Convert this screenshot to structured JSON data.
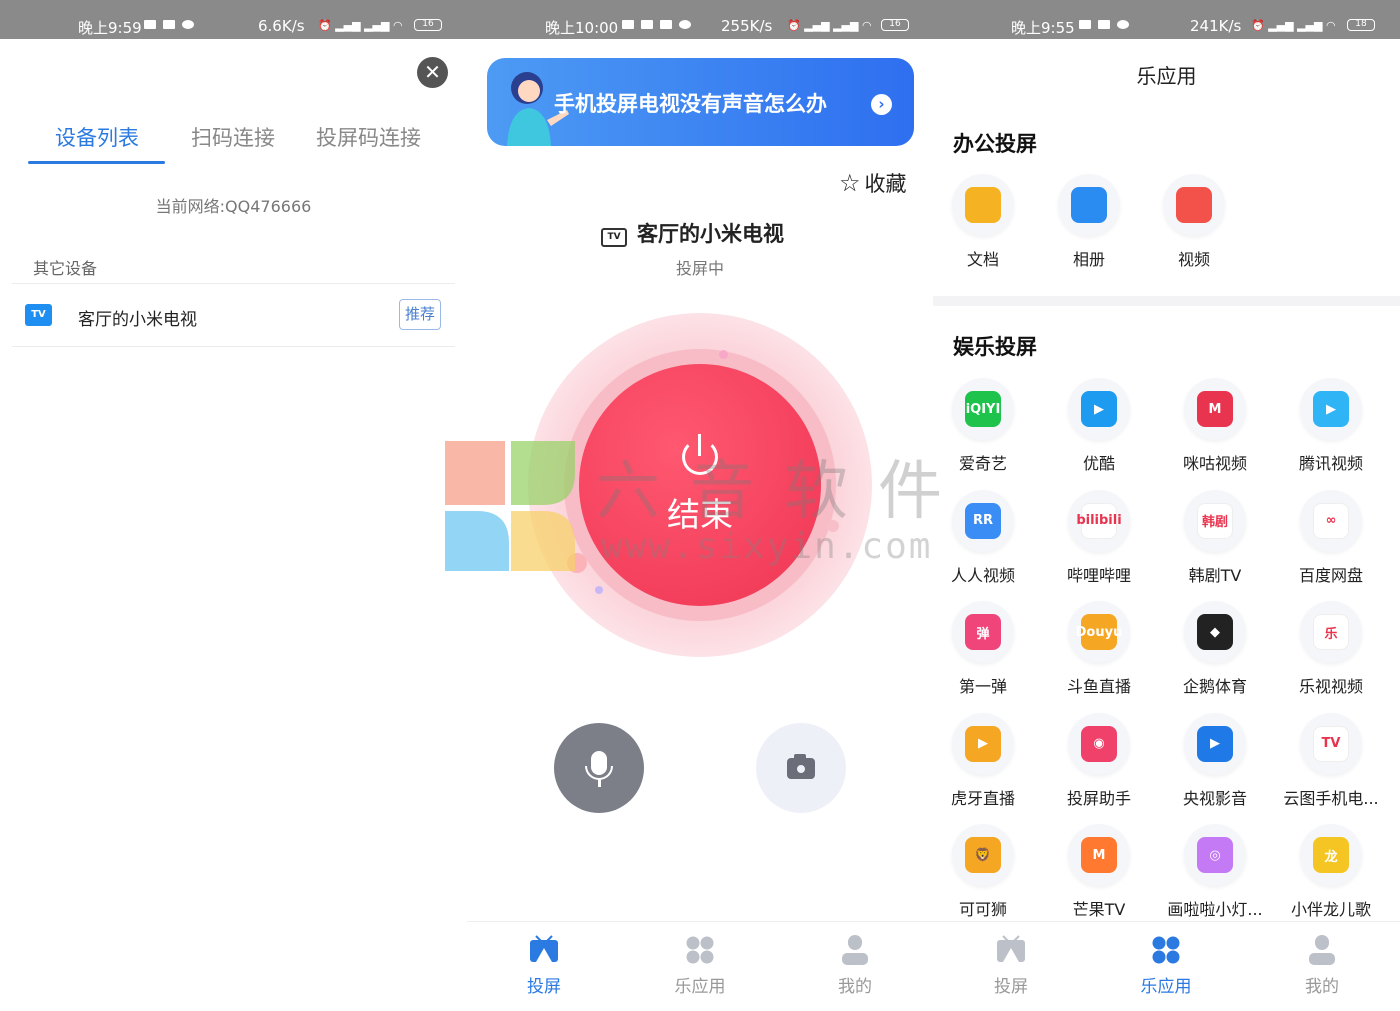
{
  "screen1": {
    "status": {
      "time": "晚上9:59",
      "speed": "6.6K/s",
      "battery": "16"
    },
    "tabs": [
      {
        "label": "设备列表",
        "active": true
      },
      {
        "label": "扫码连接",
        "active": false
      },
      {
        "label": "投屏码连接",
        "active": false
      }
    ],
    "network": "当前网络:QQ476666",
    "other_devices_label": "其它设备",
    "device": {
      "name": "客厅的小米电视",
      "badge": "推荐",
      "icon_text": "TV"
    }
  },
  "screen2": {
    "status": {
      "time": "晚上10:00",
      "speed": "255K/s",
      "battery": "16"
    },
    "banner_text": "手机投屏电视没有声音怎么办",
    "favorite_label": "收藏",
    "tv_icon_text": "TV",
    "tv_name": "客厅的小米电视",
    "casting_status": "投屏中",
    "end_label": "结束",
    "nav": [
      {
        "label": "投屏",
        "icon": "cast-icon",
        "active": true
      },
      {
        "label": "乐应用",
        "icon": "apps-icon",
        "active": false
      },
      {
        "label": "我的",
        "icon": "user-icon",
        "active": false
      }
    ]
  },
  "screen3": {
    "status": {
      "time": "晚上9:55",
      "speed": "241K/s",
      "battery": "18"
    },
    "title": "乐应用",
    "office_section": "办公投屏",
    "office_apps": [
      {
        "label": "文档",
        "icon": "folder-icon",
        "color": "#f5b324"
      },
      {
        "label": "相册",
        "icon": "photo-icon",
        "color": "#2a8cf0"
      },
      {
        "label": "视频",
        "icon": "video-icon",
        "color": "#f2524a"
      }
    ],
    "ent_section": "娱乐投屏",
    "ent_apps": [
      {
        "label": "爱奇艺",
        "icon": "iqiyi-icon",
        "color": "#1dc34b",
        "glyph": "iQIYI"
      },
      {
        "label": "优酷",
        "icon": "youku-icon",
        "color": "#1d9bf0",
        "glyph": "▶"
      },
      {
        "label": "咪咕视频",
        "icon": "migu-icon",
        "color": "#e8344e",
        "glyph": "M"
      },
      {
        "label": "腾讯视频",
        "icon": "tencent-video-icon",
        "color": "#2fb5f5",
        "glyph": "▶"
      },
      {
        "label": "人人视频",
        "icon": "renren-icon",
        "color": "#3a8df5",
        "glyph": "RR"
      },
      {
        "label": "哔哩哔哩",
        "icon": "bilibili-icon",
        "color": "#ffffff",
        "glyph": "bilibili"
      },
      {
        "label": "韩剧TV",
        "icon": "hanju-icon",
        "color": "#ffffff",
        "glyph": "韩剧"
      },
      {
        "label": "百度网盘",
        "icon": "baidu-pan-icon",
        "color": "#ffffff",
        "glyph": "∞"
      },
      {
        "label": "第一弹",
        "icon": "diyidan-icon",
        "color": "#f0457b",
        "glyph": "弹"
      },
      {
        "label": "斗鱼直播",
        "icon": "douyu-icon",
        "color": "#f5a623",
        "glyph": "Douyu"
      },
      {
        "label": "企鹅体育",
        "icon": "penguin-icon",
        "color": "#222222",
        "glyph": "◆"
      },
      {
        "label": "乐视视频",
        "icon": "letv-icon",
        "color": "#ffffff",
        "glyph": "乐"
      },
      {
        "label": "虎牙直播",
        "icon": "huya-icon",
        "color": "#f5a623",
        "glyph": "▶"
      },
      {
        "label": "投屏助手",
        "icon": "cast-helper-icon",
        "color": "#f0416a",
        "glyph": "◉"
      },
      {
        "label": "央视影音",
        "icon": "cctv-icon",
        "color": "#1f7ae8",
        "glyph": "▶"
      },
      {
        "label": "云图手机电...",
        "icon": "yuntu-tv-icon",
        "color": "#ffffff",
        "glyph": "TV"
      },
      {
        "label": "可可狮",
        "icon": "lion-icon",
        "color": "#f5a623",
        "glyph": "🦁"
      },
      {
        "label": "芒果TV",
        "icon": "mango-tv-icon",
        "color": "#ff7a30",
        "glyph": "M"
      },
      {
        "label": "画啦啦小灯...",
        "icon": "hualala-icon",
        "color": "#c47af5",
        "glyph": "◎"
      },
      {
        "label": "小伴龙儿歌",
        "icon": "xiaobanlong-icon",
        "color": "#f5c623",
        "glyph": "龙"
      }
    ],
    "nav": [
      {
        "label": "投屏",
        "icon": "cast-icon",
        "active": false
      },
      {
        "label": "乐应用",
        "icon": "apps-icon",
        "active": true
      },
      {
        "label": "我的",
        "icon": "user-icon",
        "active": false
      }
    ]
  },
  "watermark": {
    "text": "六音软件",
    "url": "www.sixyin.com"
  }
}
